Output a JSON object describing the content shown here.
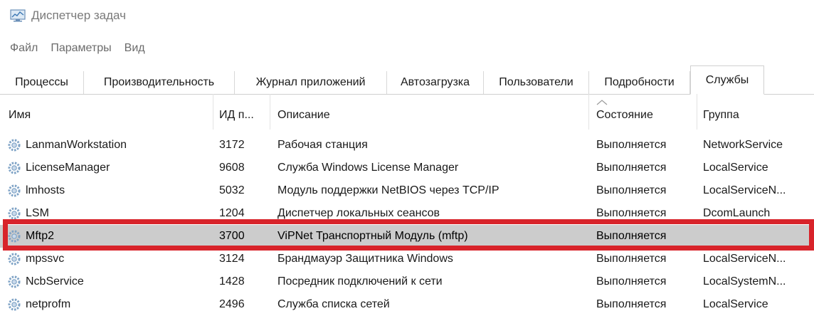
{
  "window": {
    "title": "Диспетчер задач"
  },
  "menu": [
    "Файл",
    "Параметры",
    "Вид"
  ],
  "tabs": [
    {
      "label": "Процессы",
      "active": false
    },
    {
      "label": "Производительность",
      "active": false
    },
    {
      "label": "Журнал приложений",
      "active": false
    },
    {
      "label": "Автозагрузка",
      "active": false
    },
    {
      "label": "Пользователи",
      "active": false
    },
    {
      "label": "Подробности",
      "active": false
    },
    {
      "label": "Службы",
      "active": true
    }
  ],
  "columns": {
    "name": "Имя",
    "pid": "ИД п...",
    "description": "Описание",
    "status": "Состояние",
    "group": "Группа"
  },
  "rows": [
    {
      "name": "LanmanWorkstation",
      "pid": "3172",
      "description": "Рабочая станция",
      "status": "Выполняется",
      "group": "NetworkService"
    },
    {
      "name": "LicenseManager",
      "pid": "9608",
      "description": "Служба Windows License Manager",
      "status": "Выполняется",
      "group": "LocalService"
    },
    {
      "name": "lmhosts",
      "pid": "5032",
      "description": "Модуль поддержки NetBIOS через TCP/IP",
      "status": "Выполняется",
      "group": "LocalServiceN..."
    },
    {
      "name": "LSM",
      "pid": "1204",
      "description": "Диспетчер локальных сеансов",
      "status": "Выполняется",
      "group": "DcomLaunch"
    },
    {
      "name": "Mftp2",
      "pid": "3700",
      "description": "ViPNet Транспортный Модуль (mftp)",
      "status": "Выполняется",
      "group": "",
      "selected": true
    },
    {
      "name": "mpssvc",
      "pid": "3124",
      "description": "Брандмауэр Защитника Windows",
      "status": "Выполняется",
      "group": "LocalServiceN..."
    },
    {
      "name": "NcbService",
      "pid": "1428",
      "description": "Посредник подключений к сети",
      "status": "Выполняется",
      "group": "LocalSystemN..."
    },
    {
      "name": "netprofm",
      "pid": "2496",
      "description": "Служба списка сетей",
      "status": "Выполняется",
      "group": "LocalService"
    }
  ],
  "icons": {
    "app": "task-manager-icon",
    "service": "gear-icon",
    "sort": "sort-arrow-icon"
  },
  "colors": {
    "selection": "#cccccc",
    "highlight": "#d8232a"
  }
}
